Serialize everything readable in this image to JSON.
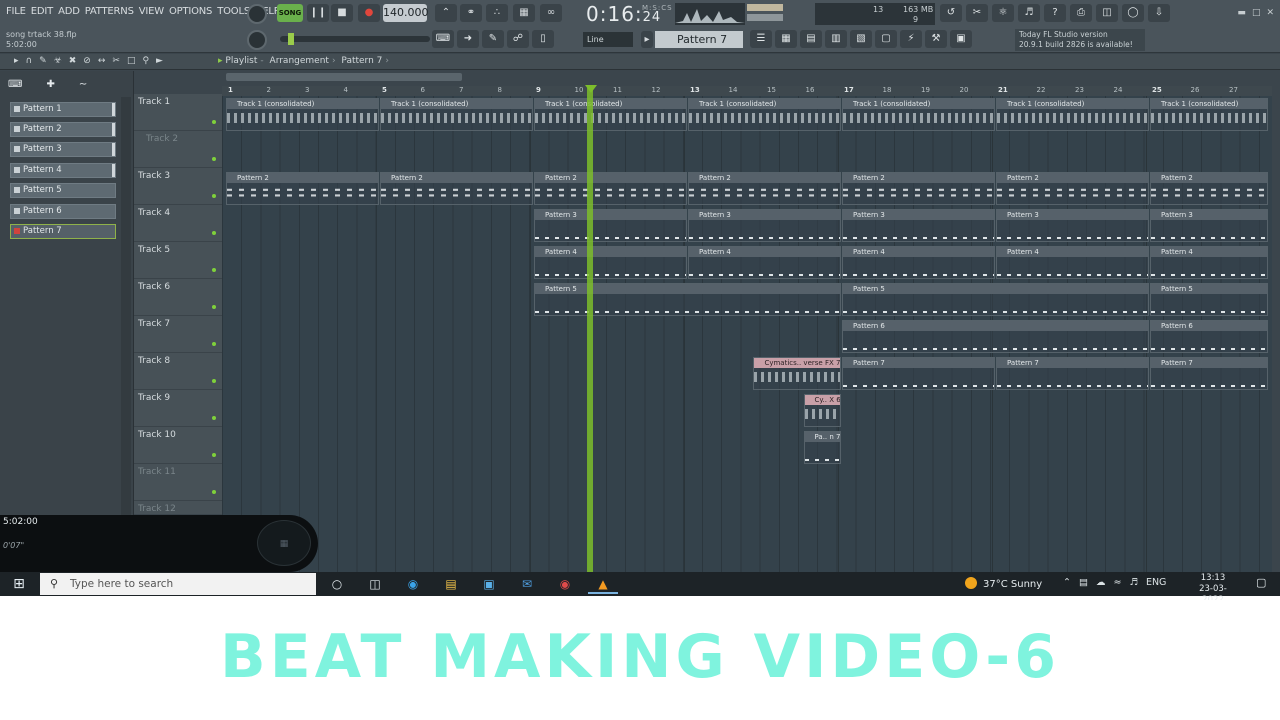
{
  "menu": [
    "FILE",
    "EDIT",
    "ADD",
    "PATTERNS",
    "VIEW",
    "OPTIONS",
    "TOOLS",
    "HELP"
  ],
  "song_file": "song trtack 38.flp",
  "song_time": "5:02:00",
  "song_small": "0'07\"",
  "transport": {
    "song_label": "SONG",
    "bpm": "140.000",
    "time_main": "0:16:",
    "time_frac": "24",
    "time_unit": "M:S:CS"
  },
  "cpu": {
    "val1": "13",
    "mem": "163 MB",
    "val2": "9"
  },
  "line_mode": "Line",
  "pattern_selector": "Pattern 7",
  "news": {
    "line1": "Today  FL Studio version",
    "line2": "20.9.1 build 2826 is available!"
  },
  "breadcrumb": [
    "Playlist",
    "Arrangement",
    "Pattern 7"
  ],
  "patterns": [
    "Pattern 1",
    "Pattern 2",
    "Pattern 3",
    "Pattern 4",
    "Pattern 5",
    "Pattern 6",
    "Pattern 7"
  ],
  "tracks": [
    "Track 1",
    "Track 2",
    "Track 3",
    "Track 4",
    "Track 5",
    "Track 6",
    "Track 7",
    "Track 8",
    "Track 9",
    "Track 10",
    "Track 11",
    "Track 12"
  ],
  "ruler": [
    "1",
    "2",
    "3",
    "4",
    "5",
    "6",
    "7",
    "8",
    "9",
    "10",
    "11",
    "12",
    "13",
    "14",
    "15",
    "16",
    "17",
    "18",
    "19",
    "20",
    "21",
    "22",
    "23",
    "24",
    "25",
    "26",
    "27"
  ],
  "clips": {
    "consolidated": "Track 1 (consolidated)",
    "p2": "Pattern 2",
    "p3": "Pattern 3",
    "p4": "Pattern 4",
    "p5": "Pattern 5",
    "p6": "Pattern 6",
    "p7": "Pattern 7",
    "cymatics": "Cymatics.. verse FX 7",
    "fx": "Cy.. X 6",
    "pa": "Pa.. n 7"
  },
  "overlay": {
    "time": "5:02:00",
    "sub": "0'07\""
  },
  "taskbar": {
    "search_placeholder": "Type here to search",
    "weather": "37°C  Sunny",
    "lang": "ENG",
    "time": "13:13",
    "date": "23-03-2022"
  },
  "caption": "BEAT MAKING VIDEO-6"
}
